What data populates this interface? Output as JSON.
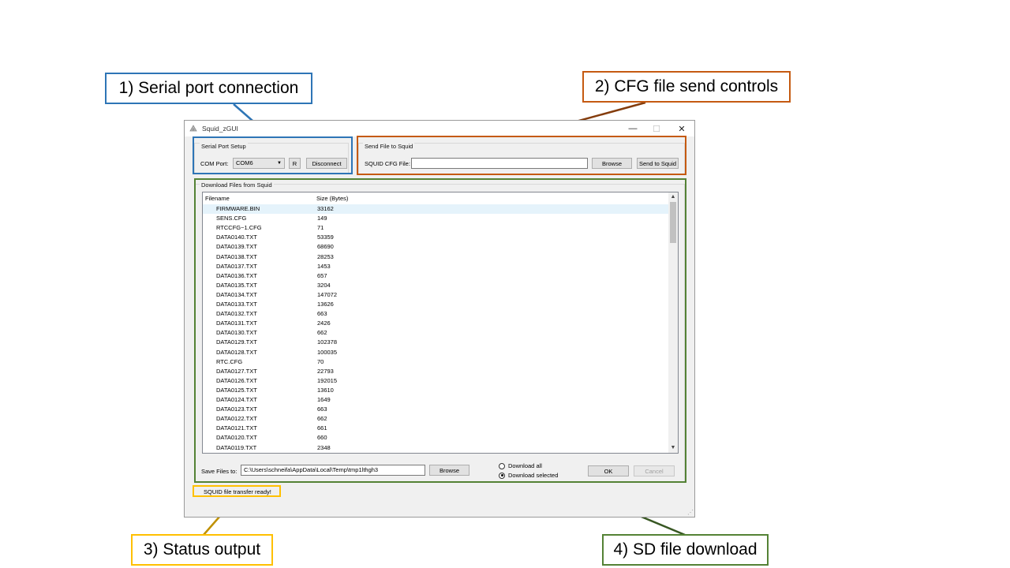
{
  "callouts": {
    "serial": "1) Serial port connection",
    "cfg": "2) CFG file send controls",
    "status": "3) Status output",
    "sd": "4) SD file download"
  },
  "colors": {
    "serial": "#2e75b6",
    "cfg": "#c55a11",
    "status": "#ffc000",
    "sd": "#548235"
  },
  "window": {
    "title": "Squid_zGUI",
    "minimize": "—",
    "maximize": "☐",
    "close": "✕"
  },
  "serial_setup": {
    "group_label": "Serial Port Setup",
    "com_label": "COM Port:",
    "com_value": "COM6",
    "refresh_label": "R",
    "disconnect_label": "Disconnect"
  },
  "send_file": {
    "group_label": "Send File to Squid",
    "cfg_label": "SQUID CFG File:",
    "cfg_value": "",
    "browse_label": "Browse",
    "send_label": "Send to Squid"
  },
  "download": {
    "group_label": "Download Files from Squid",
    "columns": [
      "Filename",
      "Size (Bytes)"
    ],
    "files": [
      [
        "FIRMWARE.BIN",
        "33162"
      ],
      [
        "SENS.CFG",
        "149"
      ],
      [
        "RTCCFG~1.CFG",
        "71"
      ],
      [
        "DATA0140.TXT",
        "53359"
      ],
      [
        "DATA0139.TXT",
        "68690"
      ],
      [
        "DATA0138.TXT",
        "28253"
      ],
      [
        "DATA0137.TXT",
        "1453"
      ],
      [
        "DATA0136.TXT",
        "657"
      ],
      [
        "DATA0135.TXT",
        "3204"
      ],
      [
        "DATA0134.TXT",
        "147072"
      ],
      [
        "DATA0133.TXT",
        "13626"
      ],
      [
        "DATA0132.TXT",
        "663"
      ],
      [
        "DATA0131.TXT",
        "2426"
      ],
      [
        "DATA0130.TXT",
        "662"
      ],
      [
        "DATA0129.TXT",
        "102378"
      ],
      [
        "DATA0128.TXT",
        "100035"
      ],
      [
        "RTC.CFG",
        "70"
      ],
      [
        "DATA0127.TXT",
        "22793"
      ],
      [
        "DATA0126.TXT",
        "192015"
      ],
      [
        "DATA0125.TXT",
        "13610"
      ],
      [
        "DATA0124.TXT",
        "1649"
      ],
      [
        "DATA0123.TXT",
        "663"
      ],
      [
        "DATA0122.TXT",
        "662"
      ],
      [
        "DATA0121.TXT",
        "661"
      ],
      [
        "DATA0120.TXT",
        "660"
      ],
      [
        "DATA0119.TXT",
        "2348"
      ]
    ],
    "save_label": "Save Files to:",
    "save_path": "C:\\Users\\schneifa\\AppData\\Local\\Temp\\tmp1lthgh3",
    "browse_label": "Browse",
    "radio_all": "Download all",
    "radio_selected": "Download selected",
    "ok_label": "OK",
    "cancel_label": "Cancel"
  },
  "status_text": "SQUID file transfer ready!"
}
